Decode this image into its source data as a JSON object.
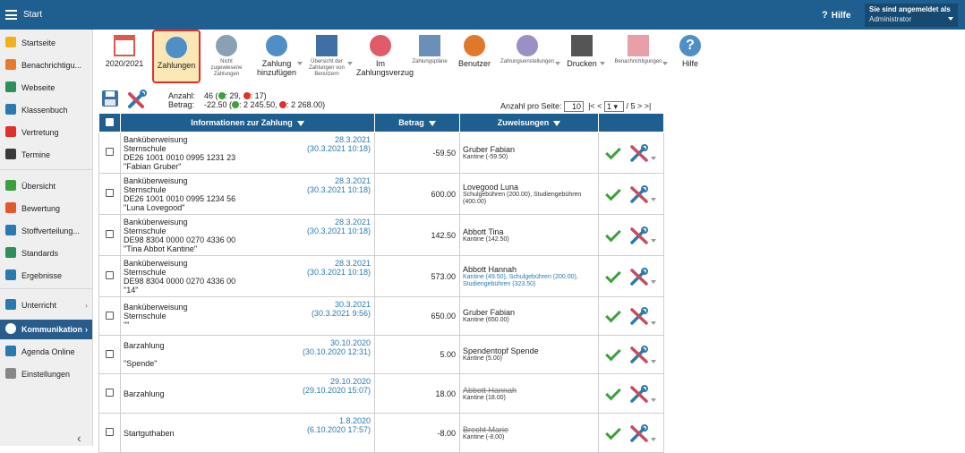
{
  "header": {
    "title": "Start",
    "help": "Hilfe",
    "user_line1": "Sie sind angemeldet als",
    "user_line2": "Administrator"
  },
  "sidebar": {
    "items": [
      {
        "label": "Startseite",
        "icon": "star-icon",
        "color": "#f2b11b"
      },
      {
        "label": "Benachrichtigu...",
        "icon": "mail-icon",
        "color": "#e87b2a"
      },
      {
        "label": "Webseite",
        "icon": "home-icon",
        "color": "#2d8f5a"
      },
      {
        "label": "Klassenbuch",
        "icon": "book-icon",
        "color": "#2a7ab0"
      },
      {
        "label": "Vertretung",
        "icon": "person-swap-icon",
        "color": "#e0302b"
      },
      {
        "label": "Termine",
        "icon": "calendar-icon",
        "color": "#3a3a3a"
      },
      {
        "label": "Übersicht",
        "icon": "check-circle-icon",
        "color": "#3ca03c"
      },
      {
        "label": "Bewertung",
        "icon": "rating-icon",
        "color": "#e05a2b"
      },
      {
        "label": "Stoffverteilung...",
        "icon": "layers-icon",
        "color": "#2a7ab0"
      },
      {
        "label": "Standards",
        "icon": "shield-icon",
        "color": "#2d8f5a"
      },
      {
        "label": "Ergebnisse",
        "icon": "chart-icon",
        "color": "#2a7ab0"
      },
      {
        "label": "Unterricht",
        "icon": "class-icon",
        "color": "#2a7ab0"
      },
      {
        "label": "Kommunikation",
        "icon": "chat-icon",
        "color": "#ffffff"
      },
      {
        "label": "Agenda Online",
        "icon": "agenda-icon",
        "color": "#2a7ab0"
      },
      {
        "label": "Einstellungen",
        "icon": "gear-icon",
        "color": "#888888"
      }
    ]
  },
  "toolbar": {
    "items": [
      {
        "label": "2020/2021",
        "icon": "calendar-icon",
        "small": false
      },
      {
        "label": "Zahlungen",
        "icon": "moneybag-icon",
        "small": false
      },
      {
        "label": "Nicht zugewiesene Zahlungen",
        "icon": "moneybag-question-icon",
        "small": true
      },
      {
        "label": "Zahlung hinzufügen",
        "icon": "moneybag-add-icon",
        "small": false
      },
      {
        "label": "Übersicht der Zahlungen von Benutzern",
        "icon": "ledger-icon",
        "small": true
      },
      {
        "label": "Im Zahlungsverzug",
        "icon": "moneybag-late-icon",
        "small": false
      },
      {
        "label": "Zahlungspläne",
        "icon": "plan-icon",
        "small": true
      },
      {
        "label": "Benutzer",
        "icon": "user-icon",
        "small": false
      },
      {
        "label": "Zahlungseinstellungen",
        "icon": "gear-icon",
        "small": true
      },
      {
        "label": "Drucken",
        "icon": "printer-icon",
        "small": false
      },
      {
        "label": "Benachrichtigungen",
        "icon": "phone-icon",
        "small": true
      },
      {
        "label": "Hilfe",
        "icon": "help-icon",
        "small": false
      }
    ]
  },
  "stats": {
    "count_label": "Anzahl:",
    "count": "46",
    "count_pos": "29,",
    "count_neg": "17)",
    "sum_label": "Betrag:",
    "sum": "-22.50",
    "sum_pos": "2 245.50,",
    "sum_neg": "2 268.00)"
  },
  "pager": {
    "per_page_label": "Anzahl pro Seite:",
    "per_page": "10",
    "first": "|<",
    "prev": "<",
    "page": "1",
    "of": "/ 5",
    "next": ">",
    "last": ">|"
  },
  "table": {
    "headers": {
      "info": "Informationen zur Zahlung",
      "amount": "Betrag",
      "assign": "Zuweisungen"
    },
    "rows": [
      {
        "info": "Banküberweisung\nSternschule\nDE26 1001 0010 0995 1231 23\n\"Fabian Gruber\"",
        "date": "28.3.2021",
        "date2": "(30.3.2021 10:18)",
        "amount": "-59.50",
        "name": "Gruber Fabian",
        "detail": "Kantine (-59.50)",
        "strike": false,
        "link": false
      },
      {
        "info": "Banküberweisung\nSternschule\nDE26 1001 0010 0995 1234 56\n\"Luna Lovegood\"",
        "date": "28.3.2021",
        "date2": "(30.3.2021 10:18)",
        "amount": "600.00",
        "name": "Lovegood Luna",
        "detail": "Schulgebühren (200.00), Studiengebühren (400.00)",
        "strike": false,
        "link": false
      },
      {
        "info": "Banküberweisung\nSternschule\nDE98 8304 0000 0270 4336 00\n\"Tina Abbot Kantine\"",
        "date": "28.3.2021",
        "date2": "(30.3.2021 10:18)",
        "amount": "142.50",
        "name": "Abbott Tina",
        "detail": "Kantine (142.50)",
        "strike": false,
        "link": false
      },
      {
        "info": "Banküberweisung\nSternschule\nDE98 8304 0000 0270 4336 00\n\"14\"",
        "date": "28.3.2021",
        "date2": "(30.3.2021 10:18)",
        "amount": "573.00",
        "name": "Abbott Hannah",
        "detail": "Kantine (49.50), Schulgebühren (200.00), Studiengebühren (323.50)",
        "strike": false,
        "link": true
      },
      {
        "info": "Banküberweisung\nSternschule\n\"\"",
        "date": "30.3.2021",
        "date2": "(30.3.2021 9:56)",
        "amount": "650.00",
        "name": "Gruber Fabian",
        "detail": "Kantine (650.00)",
        "strike": false,
        "link": false
      },
      {
        "info": "Barzahlung\n\n\"Spende\"",
        "date": "30.10.2020",
        "date2": "(30.10.2020 12:31)",
        "amount": "5.00",
        "name": "Spendentopf Spende",
        "detail": "Kantine (5.00)",
        "strike": false,
        "link": false
      },
      {
        "info": "Barzahlung",
        "date": "29.10.2020",
        "date2": "(29.10.2020 15:07)",
        "amount": "18.00",
        "name": "Abbott Hannah",
        "detail": "Kantine (18.00)",
        "strike": true,
        "link": false
      },
      {
        "info": "Startguthaben",
        "date": "1.8.2020",
        "date2": "(6.10.2020 17:57)",
        "amount": "-8.00",
        "name": "Brecht Marie",
        "detail": "Kantine (-8.00)",
        "strike": true,
        "link": false
      }
    ]
  }
}
